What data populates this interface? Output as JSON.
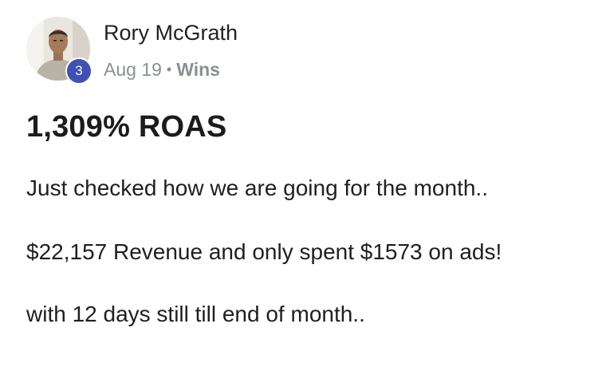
{
  "post": {
    "author": {
      "name": "Rory McGrath",
      "level": "3"
    },
    "meta": {
      "date": "Aug 19",
      "separator": "•",
      "category": "Wins"
    },
    "title": "1,309% ROAS",
    "paragraphs": [
      "Just checked how we are going for the month..",
      "$22,157 Revenue and only spent $1573 on ads!",
      "with 12 days still till end of month.."
    ]
  },
  "colors": {
    "badge": "#3f51b5",
    "meta_text": "#8a8f95",
    "title_text": "#1c1c1c"
  },
  "icons": {
    "avatar": "profile-photo"
  }
}
